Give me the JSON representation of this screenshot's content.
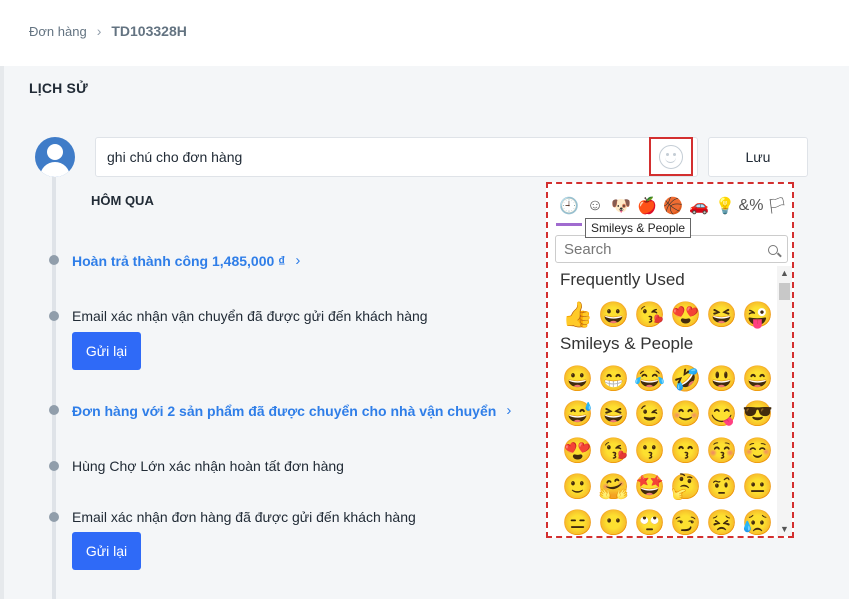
{
  "breadcrumb": {
    "parent": "Đơn hàng",
    "separator": "›",
    "current": "TD103328H"
  },
  "history": {
    "title": "LỊCH SỬ",
    "note_value": "ghi chú cho đơn hàng",
    "save_label": "Lưu",
    "day_label": "HÔM QUA",
    "events": [
      {
        "text": "Hoàn trả thành công 1,485,000 ₫",
        "type": "link"
      },
      {
        "text": "Email xác nhận vận chuyển đã được gửi đến khách hàng",
        "type": "text",
        "button": "Gửi lại"
      },
      {
        "text": "Đơn hàng với 2 sản phẩm đã được chuyển cho nhà vận chuyển",
        "type": "link"
      },
      {
        "text": "Hùng Chợ Lớn xác nhận hoàn tất đơn hàng",
        "type": "text"
      },
      {
        "text": "Email xác nhận đơn hàng đã được gửi đến khách hàng",
        "type": "text",
        "button": "Gửi lại"
      }
    ]
  },
  "emoji_picker": {
    "categories": [
      {
        "icon": "clock-icon",
        "glyph": "🕘"
      },
      {
        "icon": "smiley-icon",
        "glyph": "☺"
      },
      {
        "icon": "dog-icon",
        "glyph": "🐶"
      },
      {
        "icon": "apple-icon",
        "glyph": "🍎"
      },
      {
        "icon": "basketball-icon",
        "glyph": "🏀"
      },
      {
        "icon": "car-icon",
        "glyph": "🚗"
      },
      {
        "icon": "lightbulb-icon",
        "glyph": "💡"
      },
      {
        "icon": "symbols-icon",
        "glyph": "&%"
      },
      {
        "icon": "flag-icon",
        "glyph": "🏳"
      }
    ],
    "tooltip": "Smileys & People",
    "search_placeholder": "Search",
    "frequently_used_label": "Frequently Used",
    "frequently_used": [
      "👍",
      "😀",
      "😘",
      "😍",
      "😆",
      "😜"
    ],
    "smileys_label": "Smileys & People",
    "smileys_rows": [
      [
        "😀",
        "😁",
        "😂",
        "🤣",
        "😃",
        "😄"
      ],
      [
        "😅",
        "😆",
        "😉",
        "😊",
        "😋",
        "😎"
      ],
      [
        "😍",
        "😘",
        "😗",
        "😙",
        "😚",
        "☺️"
      ],
      [
        "🙂",
        "🤗",
        "🤩",
        "🤔",
        "🤨",
        "😐"
      ],
      [
        "😑",
        "😶",
        "🙄",
        "😏",
        "😣",
        "😥"
      ]
    ]
  }
}
